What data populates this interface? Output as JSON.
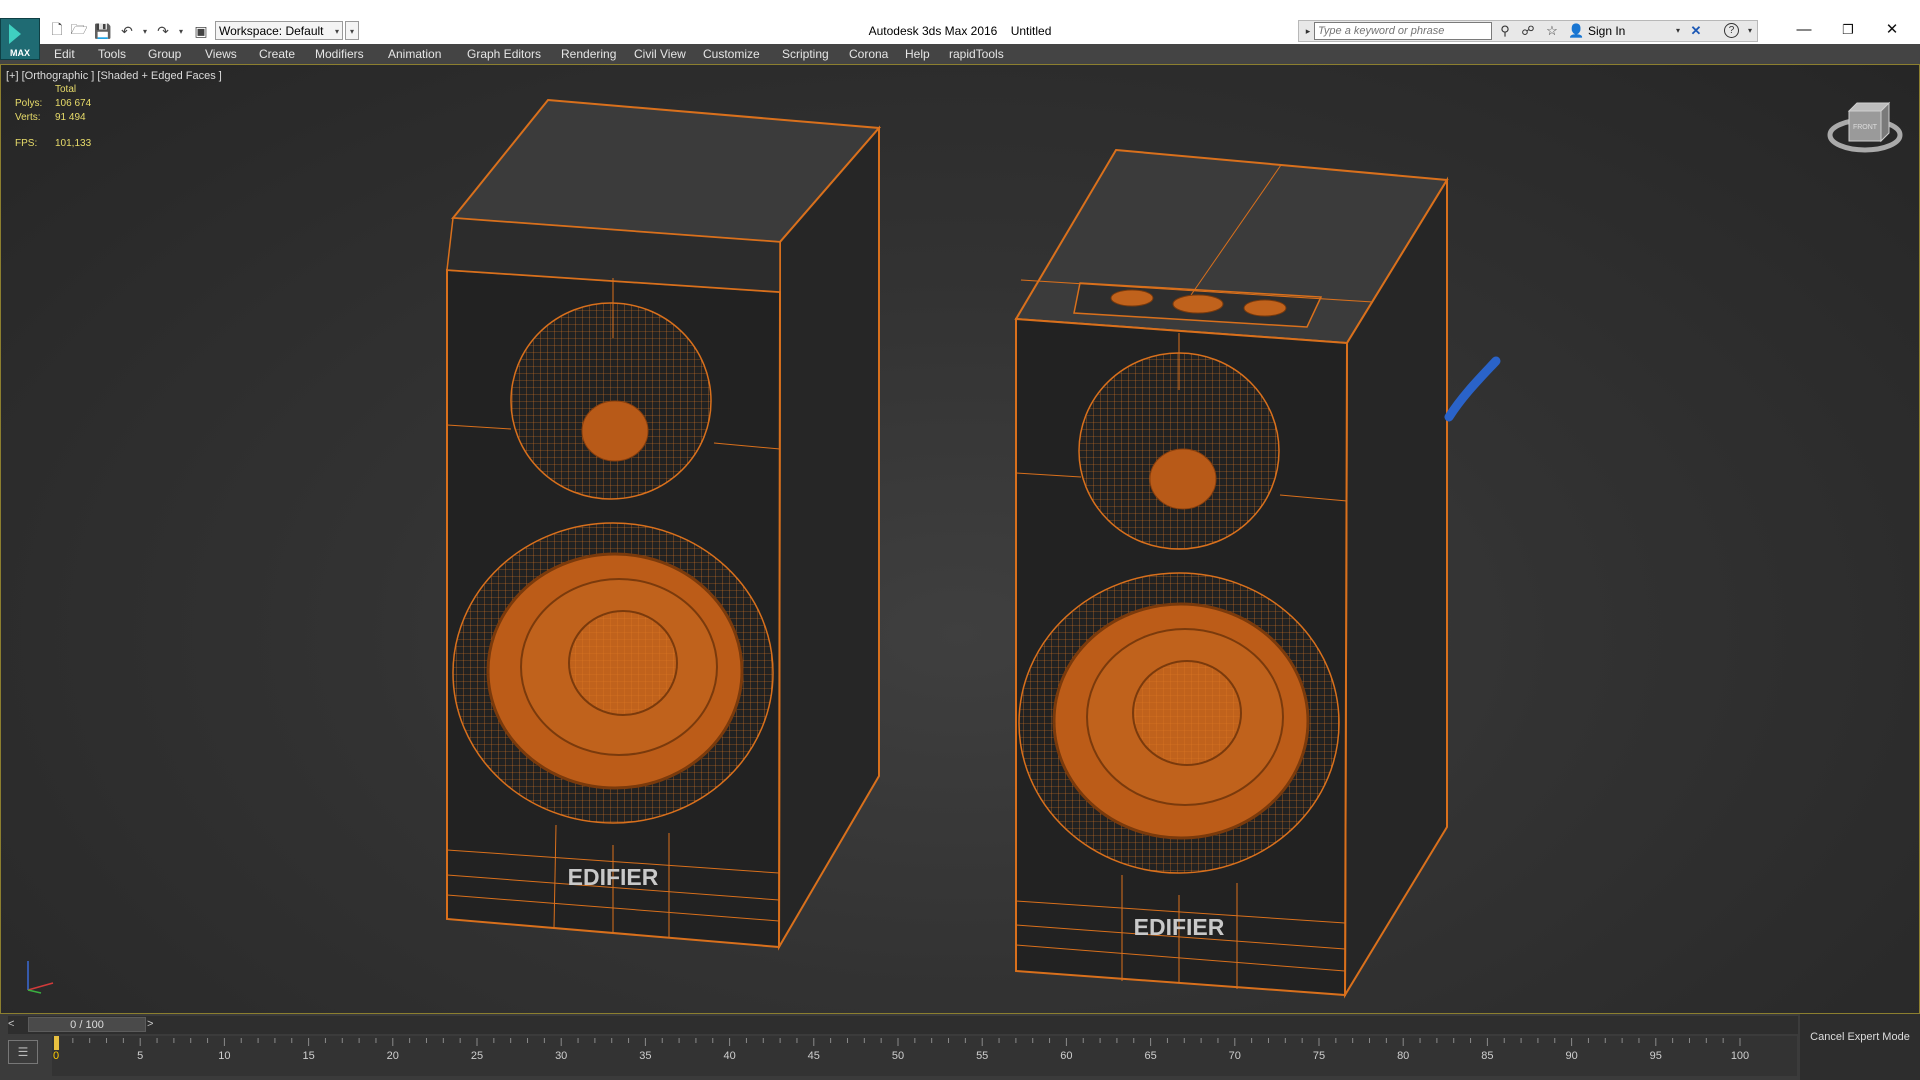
{
  "app": {
    "logo_text": "MAX",
    "title": "Autodesk 3ds Max 2016",
    "file": "Untitled",
    "workspace": "Workspace: Default"
  },
  "search": {
    "placeholder": "Type a keyword or phrase",
    "sign_in": "Sign In"
  },
  "menu": [
    "Edit",
    "Tools",
    "Group",
    "Views",
    "Create",
    "Modifiers",
    "Animation",
    "Graph Editors",
    "Rendering",
    "Civil View",
    "Customize",
    "Scripting",
    "Corona",
    "Help",
    "rapidTools"
  ],
  "viewport": {
    "label": "[+] [Orthographic ] [Shaded + Edged Faces ]",
    "stats": {
      "header": "Total",
      "polys_label": "Polys:",
      "polys_value": "106 674",
      "verts_label": "Verts:",
      "verts_value": "91 494",
      "fps_label": "FPS:",
      "fps_value": "101,133"
    },
    "brand_left": "EDIFIER",
    "brand_right": "EDIFIER",
    "viewcube_label": "FRONT"
  },
  "timeline": {
    "frame_display": "0 / 100",
    "prev": "<",
    "next": ">",
    "ticks": [
      "0",
      "5",
      "10",
      "15",
      "20",
      "25",
      "30",
      "35",
      "40",
      "45",
      "50",
      "55",
      "60",
      "65",
      "70",
      "75",
      "80",
      "85",
      "90",
      "95",
      "100"
    ],
    "cancel_expert": "Cancel Expert Mode"
  },
  "colors": {
    "wire": "#d9701c",
    "fill": "#b85a18",
    "case": "#232323",
    "top": "#3a3a3a",
    "side": "#282828",
    "accent_blue": "#2a63c9",
    "stats": "#e8dc6a"
  }
}
